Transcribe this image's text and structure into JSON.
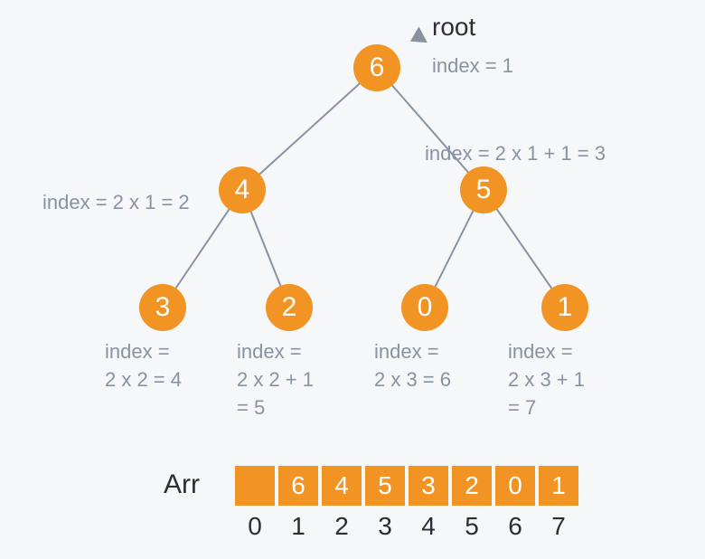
{
  "root_label": "root",
  "nodes": {
    "n1": "6",
    "n2": "4",
    "n3": "5",
    "n4": "3",
    "n5": "2",
    "n6": "0",
    "n7": "1"
  },
  "labels": {
    "root_index": "index = 1",
    "n2_index": "index = 2 x 1 = 2",
    "n3_index": "index = 2 x 1 + 1 = 3",
    "n4_index": "index =\n2 x 2 = 4",
    "n5_index": "index =\n2 x 2 + 1\n= 5",
    "n6_index": "index =\n2 x 3 = 6",
    "n7_index": "index =\n2 x 3 + 1\n= 7"
  },
  "array": {
    "label": "Arr",
    "cells": [
      "",
      "6",
      "4",
      "5",
      "3",
      "2",
      "0",
      "1"
    ],
    "indices": [
      "0",
      "1",
      "2",
      "3",
      "4",
      "5",
      "6",
      "7"
    ]
  }
}
